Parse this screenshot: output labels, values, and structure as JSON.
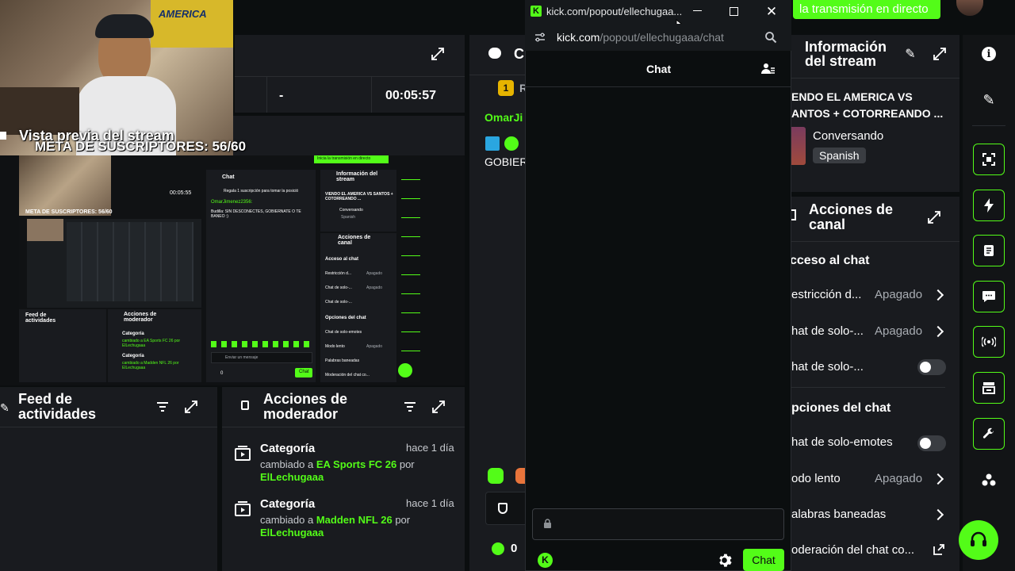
{
  "top_banner": {
    "text": "la transmisión en directo"
  },
  "webcam": {
    "overlay_title": "Vista previa del stream",
    "overlay_subtitle": "META DE SUSCRIPTORES: 56/60"
  },
  "stats_bar": {
    "dash": "-",
    "timer": "00:05:57"
  },
  "preview_title": "Vista previa del stream",
  "mini_preview": {
    "chat_title": "Chat",
    "gift_text": "Regala 1 suscripción para tomar la posició",
    "chat_user": "OmarJimenez2356:",
    "chat_user2": "Budilla: SIN DESCONECTES, GOBIERNATE O TE BANEO :)",
    "info_title": "Información del stream",
    "info_stream": "VIENDO EL AMERICA VS SANTOS + COTORREANDO ...",
    "info_cat": "Conversando",
    "info_lang": "Spanish",
    "acciones": "Acciones de canal",
    "acceso": "Acceso al chat",
    "restr": "Restricción d...",
    "solo1": "Chat de solo-...",
    "solo2": "Chat de solo-...",
    "opciones": "Opciones del chat",
    "emotes": "Chat de solo-emotes",
    "lento": "Modo lento",
    "baneadas": "Palabras baneadas",
    "moderacion": "Moderación del chat co...",
    "apagado": "Apagado",
    "feed": "Feed de actividades",
    "mod": "Acciones de moderador",
    "cat": "Categoría",
    "cat_text1": "cambiado a EA Sports FC 26 por ElLechugaaa",
    "cat_text2": "cambiado a Madden NFL 26 por ElLechugaaa",
    "send_placeholder": "Enviar un mensaje",
    "chat_btn": "Chat",
    "zero": "0",
    "meta": "META DE SUSCRIPTORES: 56/60",
    "go_live": "Inicia la transmisión en directo",
    "time": "00:05:55"
  },
  "feed": {
    "title_line1": "Feed de",
    "title_line2": "actividades"
  },
  "mod_actions": {
    "title_line1": "Acciones de",
    "title_line2": "moderador",
    "items": [
      {
        "title": "Categoría",
        "time": "hace 1 día",
        "prefix": "cambiado a",
        "category": "EA Sports FC 26",
        "by": "por",
        "user": "ElLechugaaa"
      },
      {
        "title": "Categoría",
        "time": "hace 1 día",
        "prefix": "cambiado a",
        "category": "Madden NFL 26",
        "by": "por",
        "user": "ElLechugaaa"
      }
    ]
  },
  "bg_chat": {
    "header_letter": "C",
    "rank_letter": "R",
    "rank_num": "1",
    "user": "OmarJi",
    "message": "GOBIER",
    "points": "0"
  },
  "popout": {
    "window_title": "kick.com/popout/ellechugaa...",
    "url_host": "kick.com",
    "url_path": "/popout/ellechugaaa/chat",
    "chat_header": "Chat",
    "send_button": "Chat"
  },
  "stream_info": {
    "title_line1": "Información",
    "title_line2": "del stream",
    "stream_title": "ENDO EL AMERICA VS",
    "stream_title2": "ANTOS + COTORREANDO ...",
    "category": "Conversando",
    "language": "Spanish"
  },
  "channel_actions": {
    "title_line1": "Acciones de",
    "title_line2": "canal",
    "section_access": "cceso al chat",
    "rows_access": [
      {
        "label": "estricción d...",
        "value": "Apagado"
      },
      {
        "label": "hat de solo-...",
        "value": "Apagado"
      },
      {
        "label": "hat de solo-..."
      }
    ],
    "section_options": "pciones del chat",
    "rows_options": [
      {
        "label": "hat de solo-emotes"
      },
      {
        "label": "odo lento",
        "value": "Apagado"
      },
      {
        "label": "alabras baneadas"
      },
      {
        "label": "oderación del chat co..."
      }
    ]
  },
  "colors": {
    "accent": "#53fc18",
    "panel": "#191b1f",
    "bg": "#0b0e0f"
  }
}
